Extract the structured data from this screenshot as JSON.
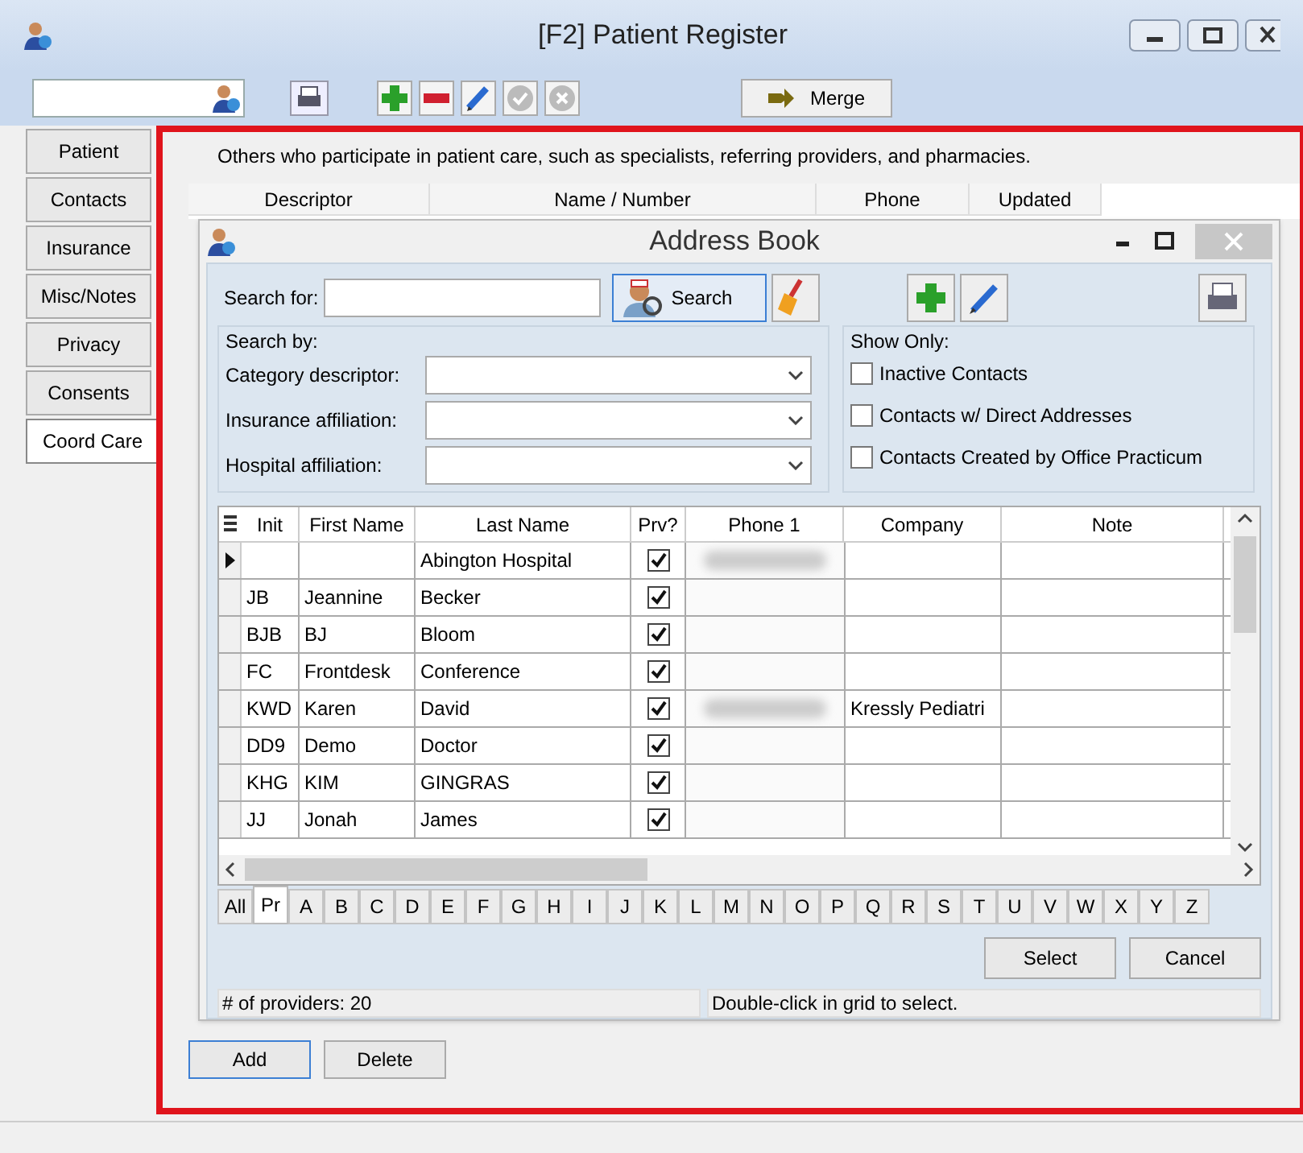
{
  "window": {
    "title": "[F2] Patient Register"
  },
  "toolbar": {
    "merge_label": "Merge"
  },
  "side_tabs": [
    {
      "label": "Patient",
      "selected": false
    },
    {
      "label": "Contacts",
      "selected": false
    },
    {
      "label": "Insurance",
      "selected": false
    },
    {
      "label": "Misc/Notes",
      "selected": false
    },
    {
      "label": "Privacy",
      "selected": false
    },
    {
      "label": "Consents",
      "selected": false
    },
    {
      "label": "Coord Care",
      "selected": true
    }
  ],
  "panel": {
    "description": "Others who participate in patient care, such as specialists, referring providers, and pharmacies.",
    "columns": [
      "Descriptor",
      "Name / Number",
      "Phone",
      "Updated"
    ],
    "buttons": [
      "Add",
      "Delete"
    ]
  },
  "dialog": {
    "title": "Address Book",
    "search_label": "Search for:",
    "search_button": "Search",
    "search_by": {
      "title": "Search by:",
      "fields": [
        {
          "label": "Category descriptor:"
        },
        {
          "label": "Insurance affiliation:"
        },
        {
          "label": "Hospital affiliation:"
        }
      ]
    },
    "show_only": {
      "title": "Show Only:",
      "options": [
        {
          "label": "Inactive Contacts",
          "checked": false
        },
        {
          "label": "Contacts w/ Direct Addresses",
          "checked": false
        },
        {
          "label": "Contacts Created by Office Practicum",
          "checked": false
        }
      ]
    },
    "grid": {
      "columns": [
        "Init",
        "First Name",
        "Last Name",
        "Prv?",
        "Phone 1",
        "Company",
        "Note"
      ],
      "rows": [
        {
          "init": "",
          "first": "",
          "last": "Abington Hospital",
          "prv": true,
          "phone_blurred": true,
          "company": "",
          "current": true
        },
        {
          "init": "JB",
          "first": "Jeannine",
          "last": "Becker",
          "prv": true,
          "phone_blurred": false,
          "company": "",
          "current": false
        },
        {
          "init": "BJB",
          "first": "BJ",
          "last": "Bloom",
          "prv": true,
          "phone_blurred": false,
          "company": "",
          "current": false
        },
        {
          "init": "FC",
          "first": "Frontdesk",
          "last": "Conference",
          "prv": true,
          "phone_blurred": false,
          "company": "",
          "current": false
        },
        {
          "init": "KWD",
          "first": "Karen",
          "last": "David",
          "prv": true,
          "phone_blurred": true,
          "company": "Kressly Pediatri",
          "current": false
        },
        {
          "init": "DD9",
          "first": "Demo",
          "last": "Doctor",
          "prv": true,
          "phone_blurred": false,
          "company": "",
          "current": false
        },
        {
          "init": "KHG",
          "first": "KIM",
          "last": "GINGRAS",
          "prv": true,
          "phone_blurred": false,
          "company": "",
          "current": false
        },
        {
          "init": "JJ",
          "first": "Jonah",
          "last": "James",
          "prv": true,
          "phone_blurred": false,
          "company": "",
          "current": false
        }
      ]
    },
    "letters": [
      {
        "label": "All",
        "selected": false
      },
      {
        "label": "Pr",
        "selected": true
      },
      {
        "label": "A",
        "selected": false
      },
      {
        "label": "B",
        "selected": false
      },
      {
        "label": "C",
        "selected": false
      },
      {
        "label": "D",
        "selected": false
      },
      {
        "label": "E",
        "selected": false
      },
      {
        "label": "F",
        "selected": false
      },
      {
        "label": "G",
        "selected": false
      },
      {
        "label": "H",
        "selected": false
      },
      {
        "label": "I",
        "selected": false
      },
      {
        "label": "J",
        "selected": false
      },
      {
        "label": "K",
        "selected": false
      },
      {
        "label": "L",
        "selected": false
      },
      {
        "label": "M",
        "selected": false
      },
      {
        "label": "N",
        "selected": false
      },
      {
        "label": "O",
        "selected": false
      },
      {
        "label": "P",
        "selected": false
      },
      {
        "label": "Q",
        "selected": false
      },
      {
        "label": "R",
        "selected": false
      },
      {
        "label": "S",
        "selected": false
      },
      {
        "label": "T",
        "selected": false
      },
      {
        "label": "U",
        "selected": false
      },
      {
        "label": "V",
        "selected": false
      },
      {
        "label": "W",
        "selected": false
      },
      {
        "label": "X",
        "selected": false
      },
      {
        "label": "Y",
        "selected": false
      },
      {
        "label": "Z",
        "selected": false
      }
    ],
    "buttons": [
      "Select",
      "Cancel"
    ],
    "status": [
      "# of providers: 20",
      "Double-click in grid to select."
    ]
  }
}
